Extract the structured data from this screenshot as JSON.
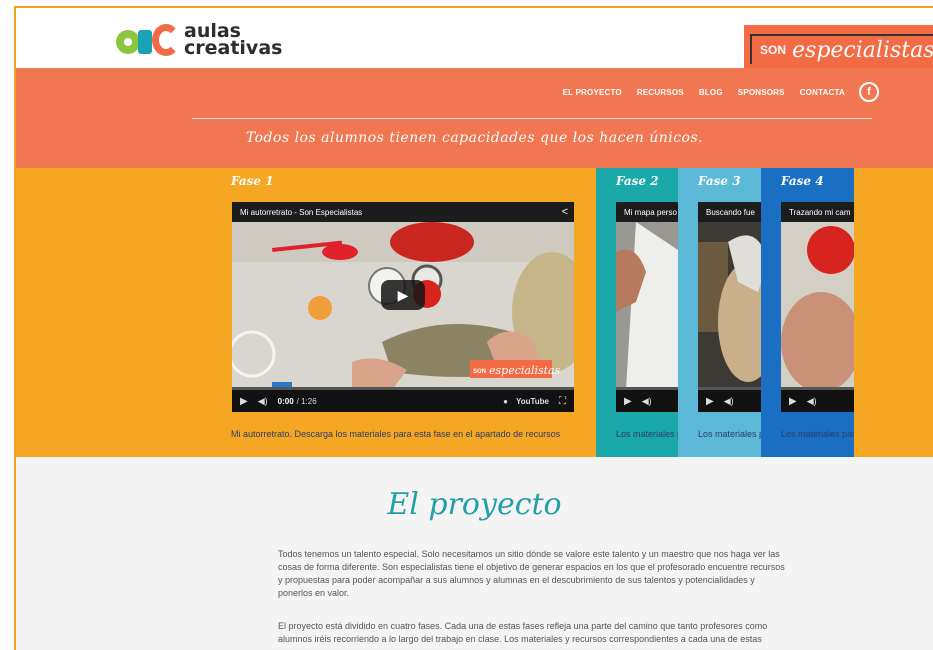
{
  "header": {
    "logo_line1": "aulas",
    "logo_line2": "creativas",
    "badge_son": "SON",
    "badge_especialistas": "especialistas"
  },
  "nav": {
    "items": [
      "EL PROYECTO",
      "RECURSOS",
      "BLOG",
      "SPONSORS",
      "CONTACTA"
    ],
    "facebook_glyph": "f"
  },
  "banner": {
    "tagline": "Todos los alumnos tienen capacidades que los hacen únicos."
  },
  "phases": [
    {
      "title": "Fase 1",
      "video_title": "Mi autorretrato - Son Especialistas",
      "time_current": "0:00",
      "time_total": "/ 1:26",
      "caption": "Mi autorretrato. Descarga los materiales para esta fase en el apartado de recursos",
      "watermark_son": "SON",
      "watermark_esp": "especialistas"
    },
    {
      "title": "Fase 2",
      "video_title": "Mi mapa perso",
      "caption": "Los materiales p"
    },
    {
      "title": "Fase 3",
      "video_title": "Buscando fue",
      "caption": "Los materiales p"
    },
    {
      "title": "Fase 4",
      "video_title": "Trazando mi cam",
      "caption": "Los materiales par"
    }
  ],
  "colors": {
    "orange_banner": "#f07752",
    "yellow_section": "#f5a623",
    "teal_phase2": "#1aa8a8",
    "lightblue_phase3": "#5bb8d6",
    "blue_phase4": "#1a6fc2",
    "title_teal": "#21a0a8"
  },
  "project": {
    "title": "El proyecto",
    "paragraph1": "Todos tenemos un talento especial. Solo necesitamos un sitio dónde se valore este talento y un maestro que nos haga ver las cosas de forma diferente. Son especialistas tiene el objetivo de generar espacios en los que el profesorado encuentre recursos y propuestas para poder acompañar a sus alumnos y alumnas en el descubrimiento de sus talentos y potencialidades y ponerlos en valor.",
    "paragraph2": "El proyecto está dividido en cuatro fases. Cada una de estas fases refleja una parte del camino que tanto profesores como alumnos iréis recorriendo a lo largo del trabajo en clase. Los materiales y recursos correspondientes a cada una de estas"
  }
}
